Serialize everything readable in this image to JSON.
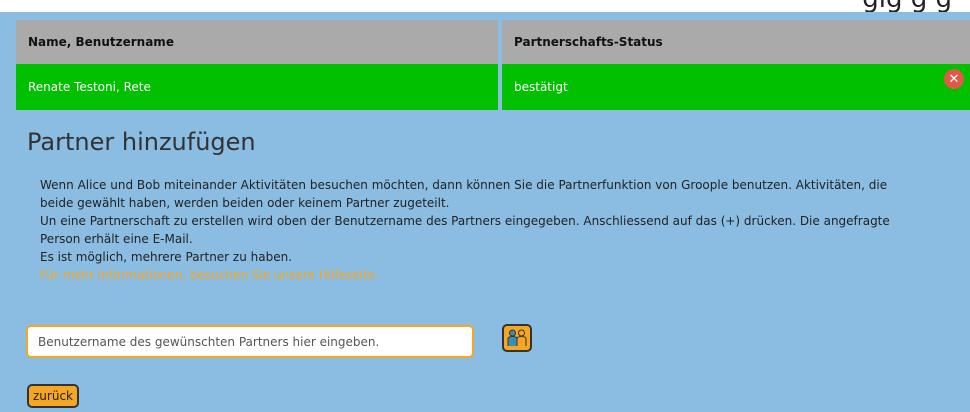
{
  "top_cut_text": "gig   g   g",
  "table": {
    "headers": [
      "Name, Benutzername",
      "Partnerschafts-Status"
    ],
    "rows": [
      {
        "name": "Renate Testoni, Rete",
        "status": "bestätigt"
      }
    ]
  },
  "section": {
    "title": "Partner hinzufügen",
    "paragraphs": [
      "Wenn Alice und Bob miteinander Aktivitäten besuchen möchten, dann können Sie die Partnerfunktion von Groople benutzen. Aktivitäten, die beide gewählt haben, werden beiden oder keinem Partner zugeteilt.",
      "Un eine Partnerschaft zu erstellen wird oben der Benutzername des Partners eingegeben. Anschliessend auf das (+) drücken. Die angefragte Person erhält eine E-Mail.",
      "Es ist möglich, mehrere Partner zu haben."
    ],
    "help_link": "Für mehr Informationen, besuchen Sie unsere Hilfeseite."
  },
  "form": {
    "placeholder": "Benutzername des gewünschten Partners hier eingeben.",
    "value": "",
    "back_label": "zurück"
  },
  "icons": {
    "remove": "close-icon",
    "add_partner": "two-people-icon"
  },
  "colors": {
    "background": "#8bbde3",
    "header_row": "#aaaaaa",
    "confirmed_row": "#00c000",
    "accent": "#f5a623",
    "remove": "#e05a4a"
  }
}
